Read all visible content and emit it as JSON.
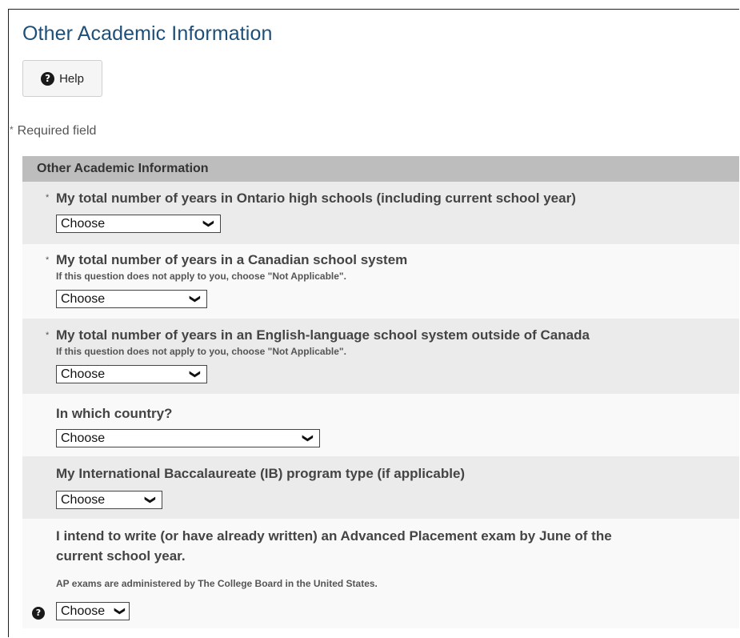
{
  "page": {
    "title": "Other Academic Information",
    "help_label": "Help",
    "required_note": "Required field",
    "required_marker": "*"
  },
  "section": {
    "header": "Other Academic Information"
  },
  "questions": [
    {
      "label": "My total number of years in Ontario high schools (including current school year)",
      "required": true,
      "hint": "",
      "select_value": "Choose"
    },
    {
      "label": "My total number of years in a Canadian school system",
      "required": true,
      "hint": "If this question does not apply to you, choose \"Not Applicable\".",
      "select_value": "Choose"
    },
    {
      "label": "My total number of years in an English-language school system outside of Canada",
      "required": true,
      "hint": "If this question does not apply to you, choose \"Not Applicable\".",
      "select_value": "Choose"
    },
    {
      "label": "In which country?",
      "required": false,
      "hint": "",
      "select_value": "Choose"
    },
    {
      "label": "My International Baccalaureate (IB) program type (if applicable)",
      "required": false,
      "hint": "",
      "select_value": "Choose"
    },
    {
      "label_line1": "I intend to write (or have already written) an Advanced Placement exam by June of the",
      "label_line2": "current school year.",
      "required": false,
      "hint": "AP exams are administered by The College Board in the United States.",
      "select_value": "Choose"
    }
  ],
  "icons": {
    "help": "question-circle-icon",
    "dropdown": "chevron-down-icon"
  },
  "colors": {
    "title": "#1d4f7a",
    "section_header_bg": "#bdbdbd",
    "row_grey": "#ebebeb",
    "row_white": "#f9f9f9"
  }
}
